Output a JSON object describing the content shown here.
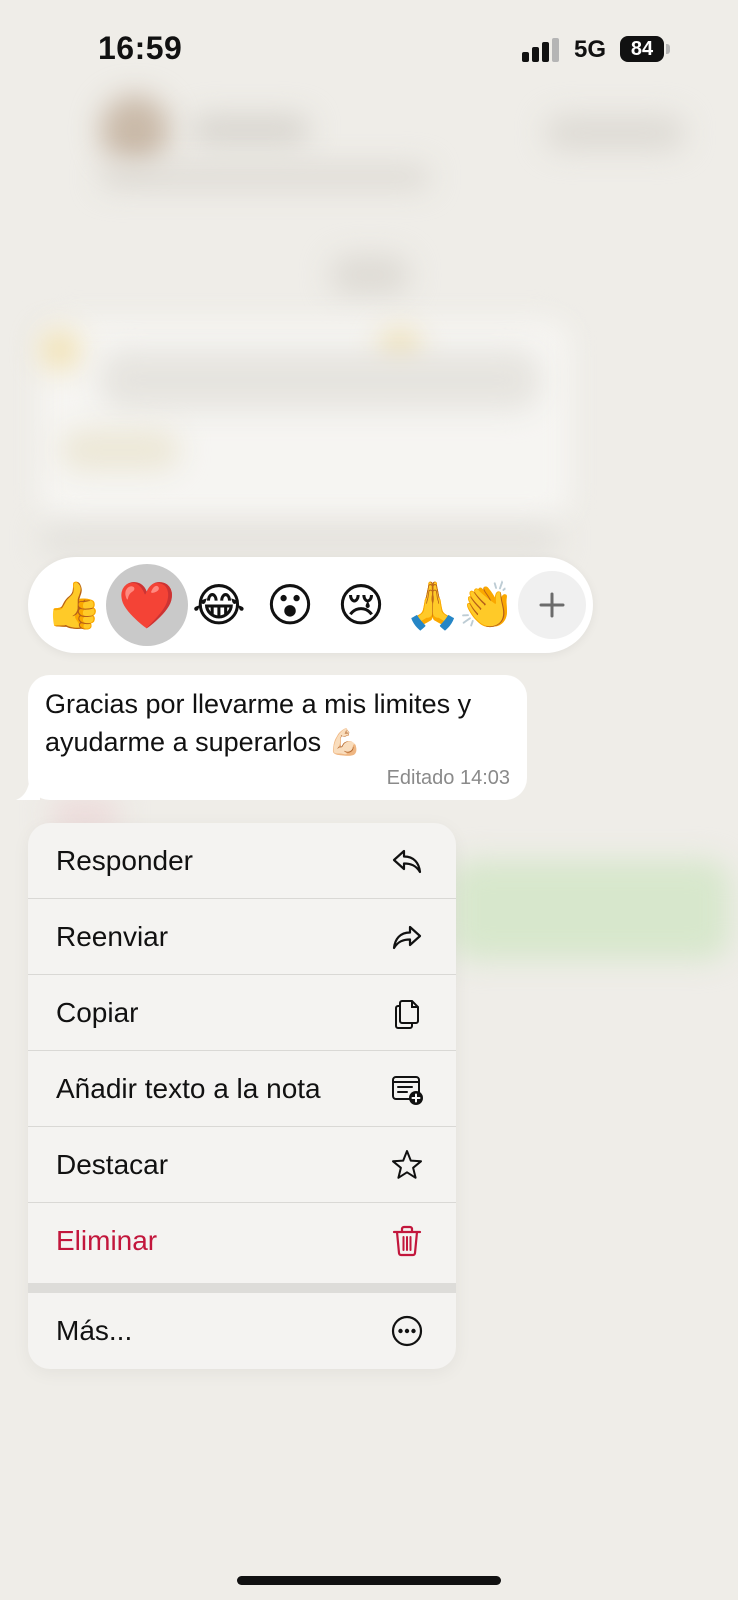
{
  "status_bar": {
    "time": "16:59",
    "network": "5G",
    "battery": "84"
  },
  "reactions": {
    "items": [
      {
        "emoji": "👍",
        "icon": "thumbs-up"
      },
      {
        "emoji": "❤️",
        "icon": "red-heart",
        "selected": true
      },
      {
        "emoji": "😂",
        "icon": "tears-of-joy"
      },
      {
        "emoji": "😮",
        "icon": "surprised-face"
      },
      {
        "emoji": "😢",
        "icon": "crying-face"
      },
      {
        "emoji": "🙏",
        "icon": "folded-hands"
      },
      {
        "emoji": "👏",
        "icon": "clapping-hands"
      }
    ],
    "more_icon": "plus-icon"
  },
  "message": {
    "text": "Gracias por llevarme a mis limites y ayudarme a superarlos",
    "emoji": "💪🏻",
    "meta": "Editado 14:03"
  },
  "menu": {
    "items": [
      {
        "label": "Responder",
        "icon": "reply-icon"
      },
      {
        "label": "Reenviar",
        "icon": "forward-icon"
      },
      {
        "label": "Copiar",
        "icon": "copy-icon"
      },
      {
        "label": "Añadir texto a la nota",
        "icon": "add-to-note-icon"
      },
      {
        "label": "Destacar",
        "icon": "star-icon"
      },
      {
        "label": "Eliminar",
        "icon": "trash-icon",
        "destructive": true
      },
      {
        "label": "Más...",
        "icon": "more-icon"
      }
    ],
    "destructive_color": "#c2163c"
  },
  "colors": {
    "background": "#efede8",
    "bubble": "#ffffff",
    "menu_background": "#f4f3f1",
    "selected_reaction": "#c9c9c9"
  }
}
